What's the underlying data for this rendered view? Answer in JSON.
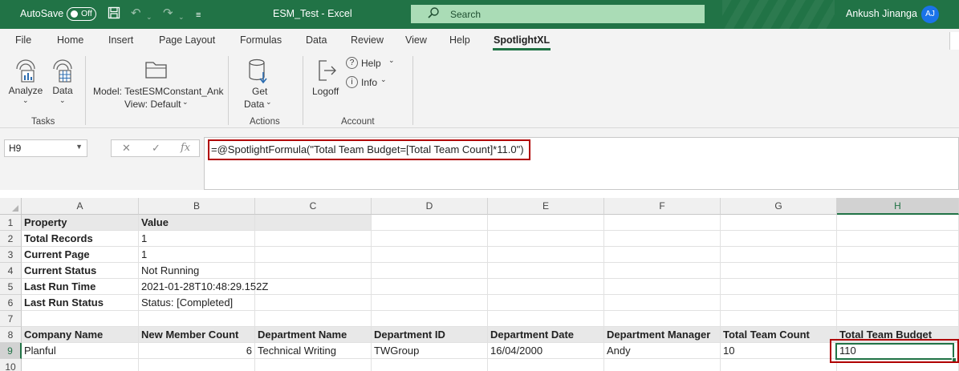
{
  "titlebar": {
    "autosave_label": "AutoSave",
    "autosave_state": "Off",
    "doc_title": "ESM_Test  -  Excel",
    "search_placeholder": "Search",
    "user_name": "Ankush Jinanga",
    "user_initials": "AJ"
  },
  "tabs": [
    "File",
    "Home",
    "Insert",
    "Page Layout",
    "Formulas",
    "Data",
    "Review",
    "View",
    "Help",
    "SpotlightXL"
  ],
  "ribbon": {
    "analyze": "Analyze",
    "data": "Data",
    "tasks_group": "Tasks",
    "model_line1": "Model: TestESMConstant_Ank",
    "model_line2": "View: Default",
    "get_data_1": "Get",
    "get_data_2": "Data",
    "actions_group": "Actions",
    "logoff": "Logoff",
    "help": "Help",
    "info": "Info",
    "account_group": "Account"
  },
  "formula_bar": {
    "name_box": "H9",
    "cancel": "✕",
    "enter": "✓",
    "fx": "fx",
    "formula": "=@SpotlightFormula(\"Total Team Budget=[Total Team Count]*11.0\")"
  },
  "sheet": {
    "columns": [
      "A",
      "B",
      "C",
      "D",
      "E",
      "F",
      "G",
      "H"
    ],
    "rows": [
      "1",
      "2",
      "3",
      "4",
      "5",
      "6",
      "7",
      "8",
      "9",
      "10"
    ],
    "properties": [
      [
        "Property",
        "Value"
      ],
      [
        "Total Records",
        "1"
      ],
      [
        "Current Page",
        "1"
      ],
      [
        "Current Status",
        "Not Running"
      ],
      [
        "Last Run Time",
        "2021-01-28T10:48:29.152Z"
      ],
      [
        "Last Run Status",
        "Status: [Completed]"
      ]
    ],
    "table_headers": [
      "Company Name",
      "New Member Count",
      "Department Name",
      "Department ID",
      "Department Date",
      "Department Manager",
      "Total Team Count",
      "Total Team Budget"
    ],
    "table_row": [
      "Planful",
      "6",
      "Technical Writing",
      "TWGroup",
      "16/04/2000",
      "Andy",
      "10",
      "110"
    ]
  },
  "colors": {
    "excel_green": "#217346",
    "highlight_red": "#b00000",
    "search_bg": "#aadcb6"
  }
}
